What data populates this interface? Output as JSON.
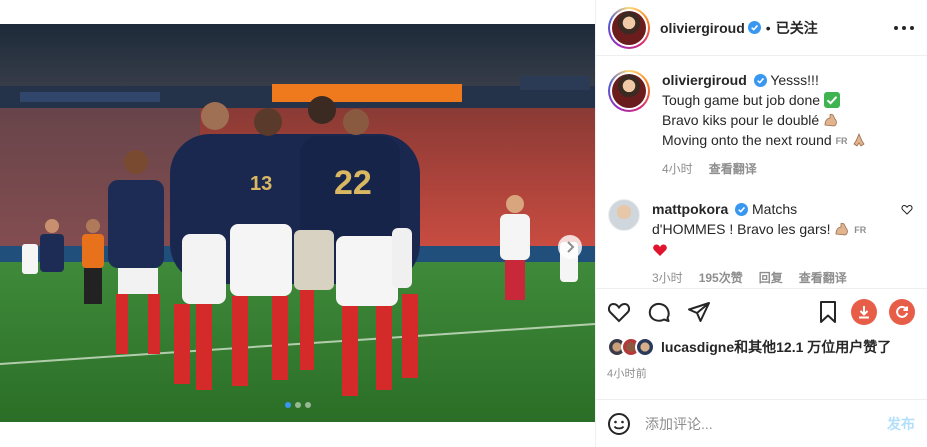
{
  "post": {
    "username": "oliviergiroud",
    "separator": "•",
    "follow_status": "已关注",
    "more_icon": "more-horizontal-icon",
    "verified_icon": "verified-badge-icon",
    "photo_description_icon": "match-photo",
    "carousel": {
      "current": 1,
      "total": 3,
      "next_icon": "chevron-right-icon"
    }
  },
  "caption": {
    "username": "oliviergiroud",
    "line1": "Yesss!!!",
    "line2": "Tough game but job done",
    "line3": "Bravo kiks pour le doublé",
    "line4": "Moving onto the next round",
    "fr_tag": "FR",
    "time": "4小时",
    "translate": "查看翻译"
  },
  "comment": {
    "username": "mattpokora",
    "text_line1": "Matchs",
    "text_line2": "d'HOMMES ! Bravo les gars!",
    "fr_tag": "FR",
    "time": "3小时",
    "likes": "195次赞",
    "reply": "回复",
    "translate": "查看翻译",
    "like_icon": "heart-outline-icon"
  },
  "actions": {
    "like_icon": "heart-outline-icon",
    "comment_icon": "comment-bubble-icon",
    "share_icon": "paper-plane-icon",
    "save_icon": "bookmark-icon",
    "download_icon": "download-icon",
    "refresh_icon": "refresh-icon",
    "likes_text": "lucasdigne和其他12.1 万位用户赞了",
    "post_time": "4小时前"
  },
  "composer": {
    "placeholder": "添加评论...",
    "post_label": "发布",
    "emoji_icon": "smile-icon"
  },
  "colors": {
    "accent": "#0095f6",
    "verified": "#3897f0",
    "heart_red": "#ed4956",
    "download_red": "#e85d48"
  }
}
